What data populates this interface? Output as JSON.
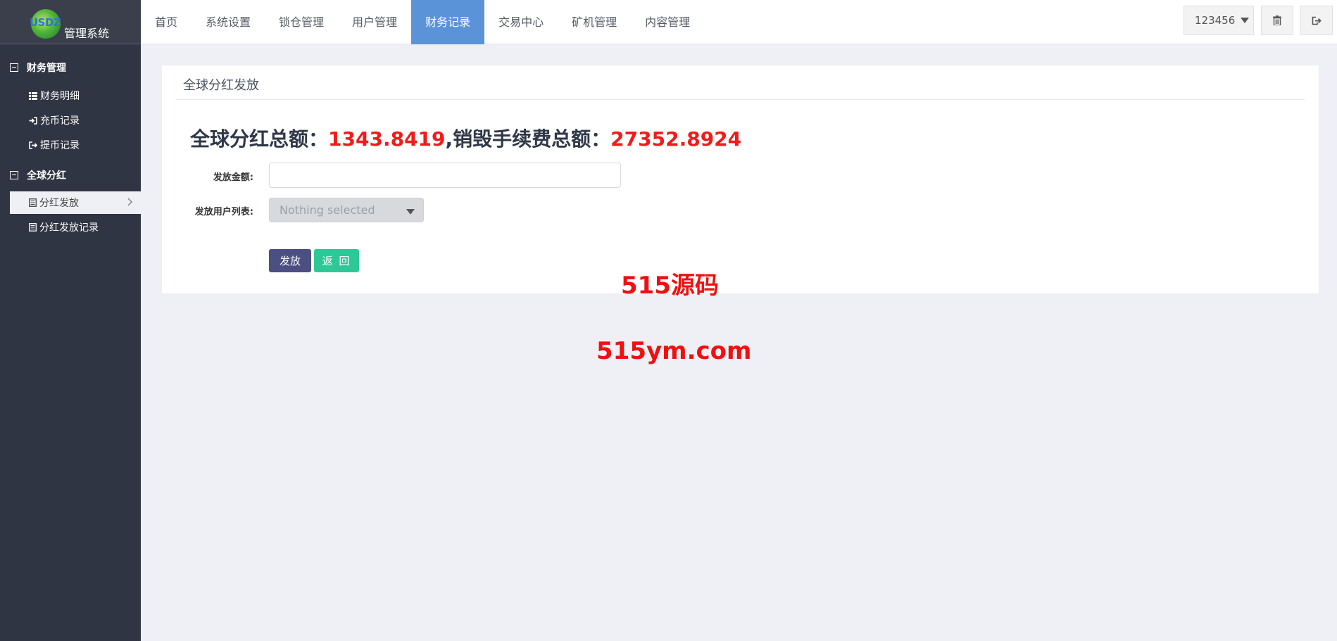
{
  "brand": {
    "logo_text": "USDZ",
    "title": "管理系统"
  },
  "topnav": [
    {
      "label": "首页",
      "active": false
    },
    {
      "label": "系统设置",
      "active": false
    },
    {
      "label": "锁仓管理",
      "active": false
    },
    {
      "label": "用户管理",
      "active": false
    },
    {
      "label": "财务记录",
      "active": true
    },
    {
      "label": "交易中心",
      "active": false
    },
    {
      "label": "矿机管理",
      "active": false
    },
    {
      "label": "内容管理",
      "active": false
    }
  ],
  "user": {
    "name": "123456"
  },
  "top_icons": [
    "trash-icon",
    "logout-icon"
  ],
  "sidebar": {
    "groups": [
      {
        "label": "财务管理",
        "items": [
          {
            "label": "财务明细",
            "icon": "list-icon"
          },
          {
            "label": "充币记录",
            "icon": "sign-in-icon"
          },
          {
            "label": "提币记录",
            "icon": "sign-out-icon"
          }
        ]
      },
      {
        "label": "全球分红",
        "items": [
          {
            "label": "分红发放",
            "icon": "document-icon",
            "active": true
          },
          {
            "label": "分红发放记录",
            "icon": "document-icon"
          }
        ]
      }
    ]
  },
  "main": {
    "panel_title": "全球分红发放",
    "summary": {
      "dividend_label": "全球分红总额：",
      "dividend_value": "1343.8419",
      "fee_label": ",销毁手续费总额：",
      "fee_value": "27352.8924"
    },
    "form": {
      "amount_label": "发放金额:",
      "amount_value": "",
      "users_label": "发放用户列表:",
      "users_placeholder": "Nothing selected"
    },
    "buttons": {
      "submit": "发放",
      "back": "返 回"
    }
  },
  "watermarks": [
    "515源码",
    "515ym.com"
  ],
  "colors": {
    "nav_active": "#5b93d8",
    "sidebar_bg": "#2f3542",
    "highlight_red": "#f31a1a",
    "btn_primary": "#4b4f82",
    "btn_success": "#2ec896"
  }
}
